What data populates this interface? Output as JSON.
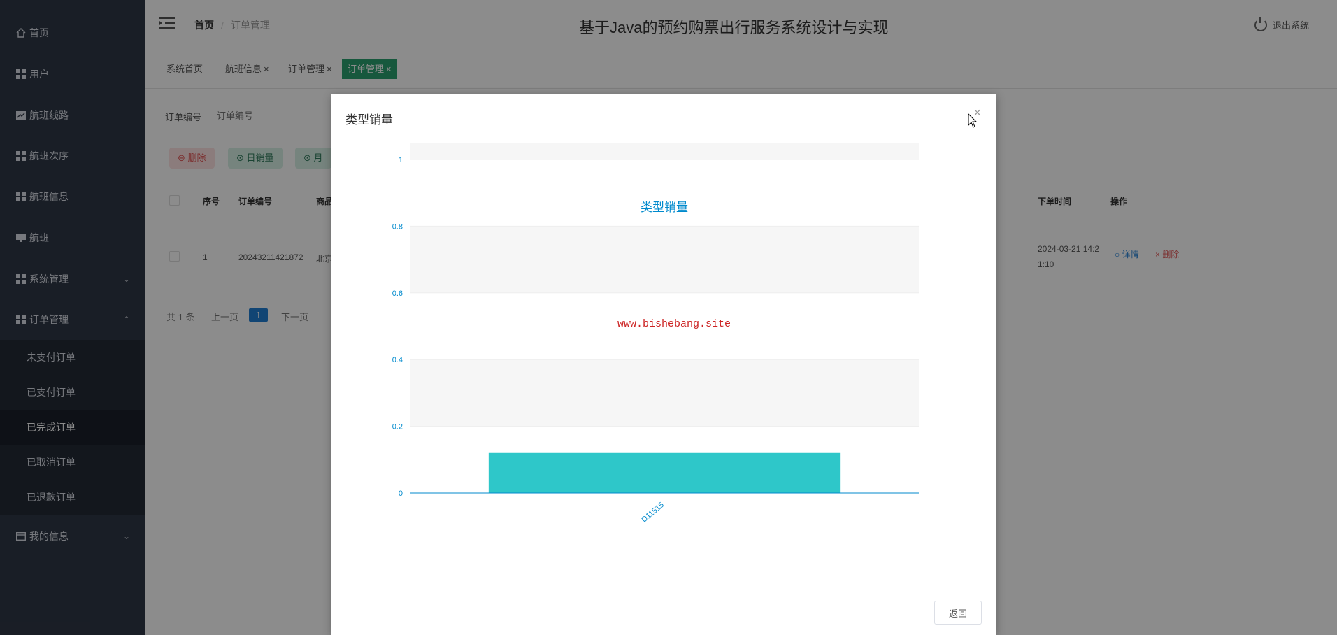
{
  "sidebar": {
    "items": [
      {
        "label": "首页",
        "icon": "home-icon"
      },
      {
        "label": "用户",
        "icon": "grid-icon"
      },
      {
        "label": "航班线路",
        "icon": "chart-icon"
      },
      {
        "label": "航班次序",
        "icon": "grid-icon"
      },
      {
        "label": "航班信息",
        "icon": "grid-icon"
      },
      {
        "label": "航班",
        "icon": "monitor-icon"
      },
      {
        "label": "系统管理",
        "icon": "grid-icon"
      },
      {
        "label": "订单管理",
        "icon": "grid-icon"
      },
      {
        "label": "我的信息",
        "icon": "card-icon"
      }
    ],
    "order_submenu": [
      "未支付订单",
      "已支付订单",
      "已完成订单",
      "已取消订单",
      "已退款订单"
    ]
  },
  "header": {
    "breadcrumb_home": "首页",
    "breadcrumb_current": "订单管理",
    "system_title": "基于Java的预约购票出行服务系统设计与实现",
    "logout_label": "退出系统"
  },
  "tabs": [
    {
      "label": "系统首页",
      "closable": false
    },
    {
      "label": "航班信息",
      "closable": true
    },
    {
      "label": "订单管理",
      "closable": true
    },
    {
      "label": "订单管理",
      "closable": true,
      "active": true
    }
  ],
  "content": {
    "filter_label": "订单编号",
    "filter_placeholder": "订单编号",
    "btn_delete": "删除",
    "btn_day_sales": "日销量",
    "btn_month_sales": "月",
    "table": {
      "headers": [
        "序号",
        "订单编号",
        "商品",
        "下单时间",
        "操作"
      ],
      "row": {
        "index": "1",
        "order_no": "20243211421872",
        "goods": "北京",
        "time_line1": "2024-03-21 14:2",
        "time_line2": "1:10",
        "detail": "详情",
        "delete": "删除"
      }
    },
    "pager": {
      "total": "共 1 条",
      "prev": "上一页",
      "current": "1",
      "next": "下一页"
    }
  },
  "modal": {
    "title": "类型销量",
    "close_symbol": "×",
    "back_button": "返回",
    "watermark": "www.bishebang.site"
  },
  "chart_data": {
    "type": "bar",
    "title": "类型销量",
    "categories": [
      "D11515"
    ],
    "values": [
      0.12
    ],
    "ylim": [
      0,
      1
    ],
    "yticks": [
      "0",
      "0.2",
      "0.4",
      "0.6",
      "0.8",
      "1"
    ],
    "bar_color": "#2ec7c9",
    "title_color": "#008acd",
    "grid": true
  }
}
